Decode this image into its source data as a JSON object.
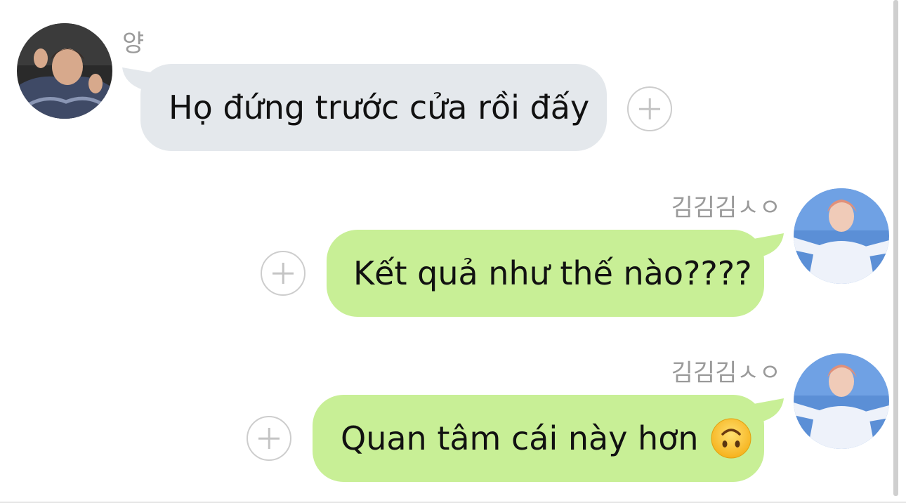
{
  "messages": [
    {
      "direction": "incoming",
      "sender": "양",
      "text": "Họ đứng trước cửa rồi đấy",
      "emoji": null
    },
    {
      "direction": "outgoing",
      "sender": "김김김ㅅㅇ",
      "text": "Kết quả như thế nào????",
      "emoji": null
    },
    {
      "direction": "outgoing",
      "sender": "김김김ㅅㅇ",
      "text": "Quan tâm cái này hơn",
      "emoji": "upside-down-face"
    }
  ],
  "colors": {
    "incoming_bubble": "#e4e8ec",
    "outgoing_bubble": "#c8ef96",
    "sender_name": "#9a9a9a",
    "react_button": "#cdcdcd"
  },
  "icons": {
    "react_button": "plus-circle-icon"
  }
}
